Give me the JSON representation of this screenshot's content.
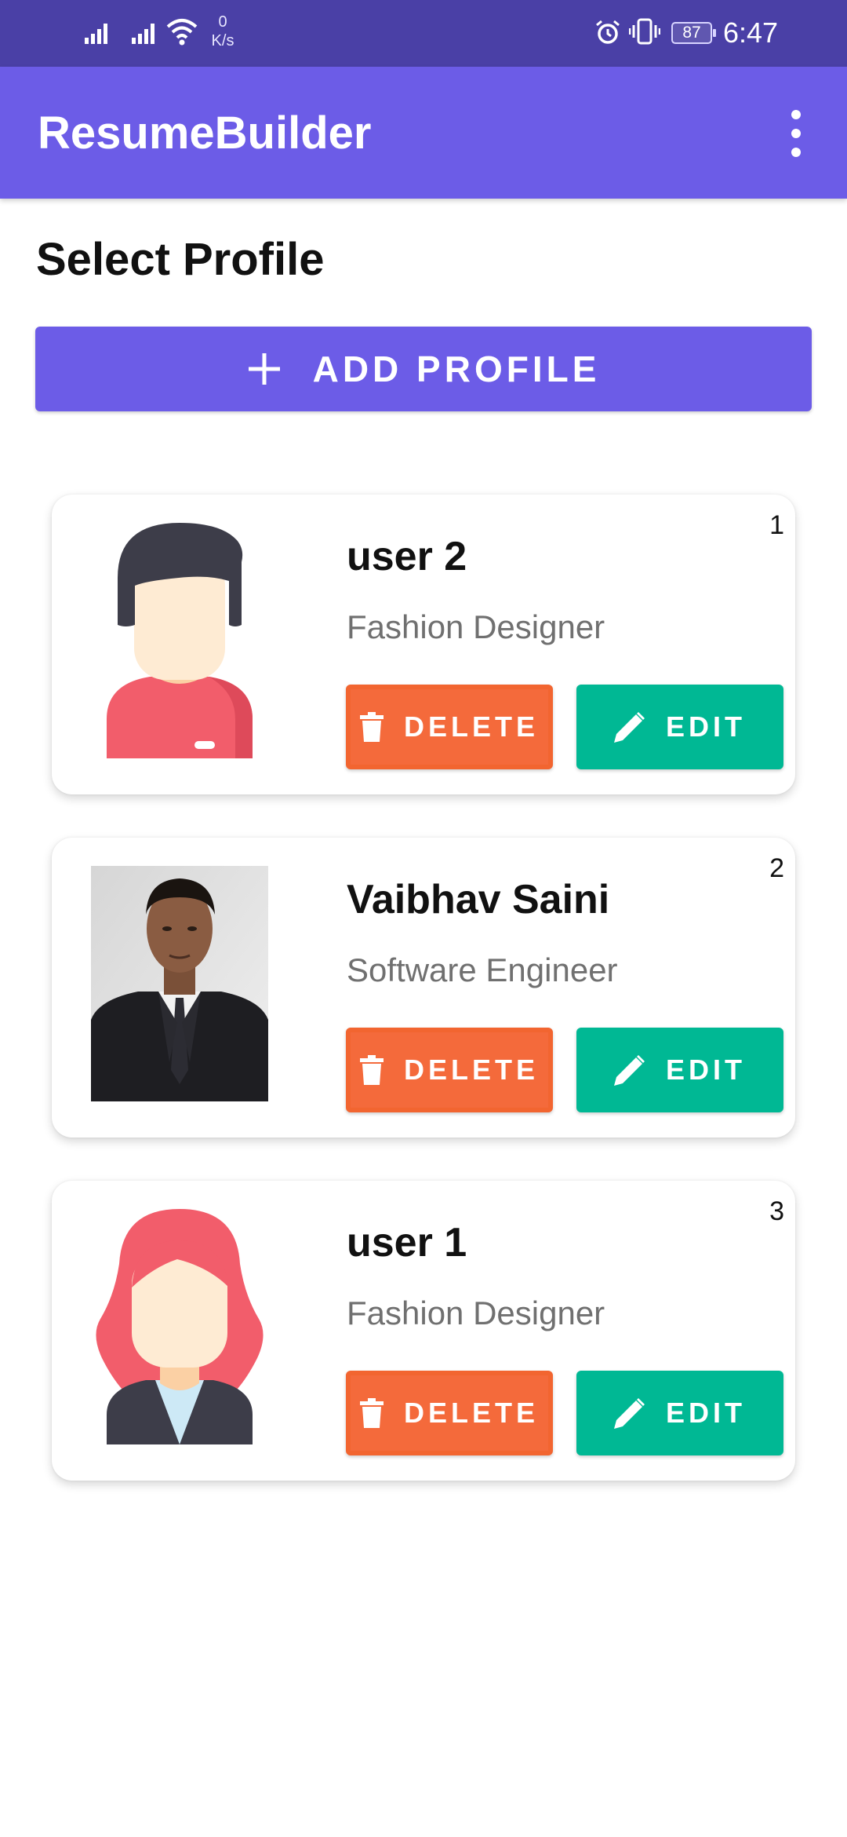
{
  "status_bar": {
    "net_speed_value": "0",
    "net_speed_unit": "K/s",
    "battery": "87",
    "time": "6:47",
    "icons": [
      "signal-icon",
      "signal-icon",
      "wifi-icon",
      "alarm-icon",
      "vibrate-icon",
      "battery-icon"
    ]
  },
  "app_bar": {
    "title": "ResumeBuilder",
    "menu_icon": "more-vert-icon"
  },
  "page": {
    "title": "Select Profile",
    "add_button_label": "ADD PROFILE",
    "add_button_icon": "plus-icon"
  },
  "profiles": [
    {
      "index": "1",
      "name": "user 2",
      "role": "Fashion Designer",
      "avatar": "male-avatar-icon",
      "delete_label": "DELETE",
      "edit_label": "EDIT"
    },
    {
      "index": "2",
      "name": "Vaibhav Saini",
      "role": "Software Engineer",
      "avatar": "profile-photo",
      "delete_label": "DELETE",
      "edit_label": "EDIT"
    },
    {
      "index": "3",
      "name": "user 1",
      "role": "Fashion Designer",
      "avatar": "female-avatar-icon",
      "delete_label": "DELETE",
      "edit_label": "EDIT"
    }
  ],
  "colors": {
    "status_bar": "#4a40a6",
    "primary": "#6c5ce7",
    "delete": "#f46a3b",
    "edit": "#00b894",
    "text_secondary": "#707070"
  }
}
